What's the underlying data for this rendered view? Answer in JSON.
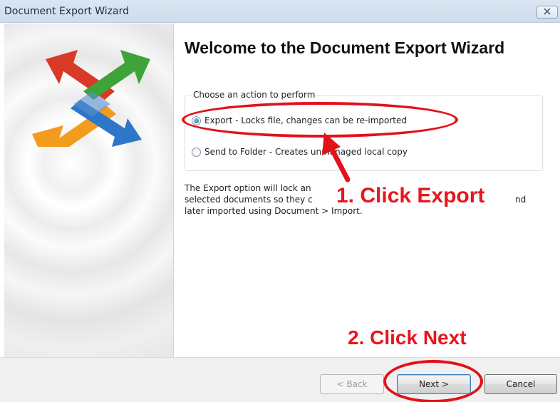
{
  "window": {
    "title": "Document Export Wizard",
    "close_icon": "close-x-icon"
  },
  "sidebar": {
    "logo_icon": "four-way-arrows-logo-icon"
  },
  "main": {
    "heading": "Welcome to the Document Export Wizard",
    "group_legend": "Choose an action to perform",
    "options": [
      {
        "label": "Export - Locks file, changes can be re-imported",
        "selected": true
      },
      {
        "label": "Send to Folder - Creates unmanaged local copy",
        "selected": false
      }
    ],
    "description_lines": [
      "The Export option will lock an",
      "selected documents so they c",
      "later imported using Document > Import."
    ],
    "description_tail": "nd"
  },
  "buttons": {
    "back": "< Back",
    "next": "Next >",
    "cancel": "Cancel"
  },
  "annotations": {
    "step1": "1. Click Export",
    "step2": "2. Click Next",
    "color": "#e3111a"
  }
}
